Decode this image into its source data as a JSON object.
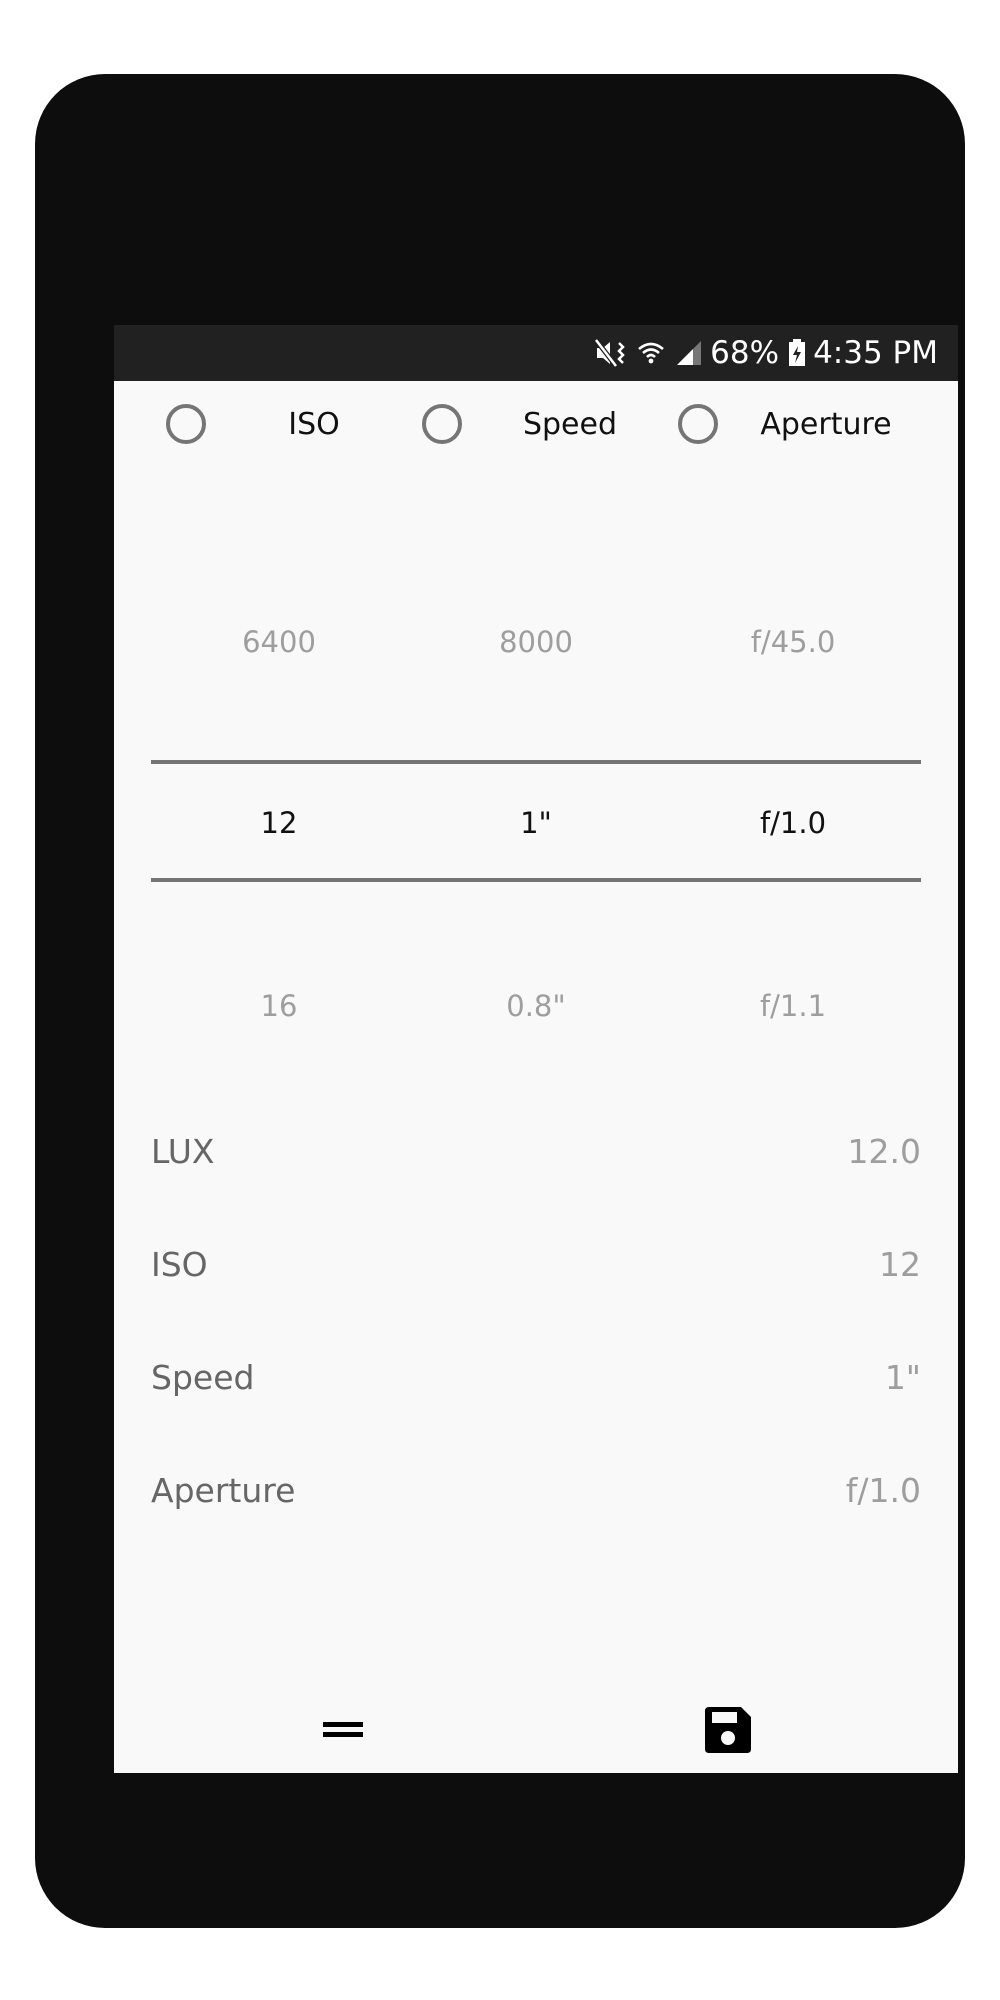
{
  "status_bar": {
    "battery_text": "68%",
    "time": "4:35 PM",
    "icons": [
      "mute-vibrate-icon",
      "wifi-icon",
      "signal-icon",
      "battery-charging-icon"
    ]
  },
  "mode_selector": {
    "options": [
      {
        "label": "ISO",
        "selected": false
      },
      {
        "label": "Speed",
        "selected": false
      },
      {
        "label": "Aperture",
        "selected": false
      }
    ]
  },
  "pickers": {
    "iso": {
      "prev": "6400",
      "current": "12",
      "next": "16"
    },
    "speed": {
      "prev": "8000",
      "current": "1\"",
      "next": "0.8\""
    },
    "aperture": {
      "prev": "f/45.0",
      "current": "f/1.0",
      "next": "f/1.1"
    }
  },
  "readings": [
    {
      "label": "LUX",
      "value": "12.0"
    },
    {
      "label": "ISO",
      "value": "12"
    },
    {
      "label": "Speed",
      "value": "1\""
    },
    {
      "label": "Aperture",
      "value": "f/1.0"
    }
  ],
  "bottom_bar": {
    "left_icon": "equals-icon",
    "right_icon": "save-icon"
  },
  "colors": {
    "device": "#0d0d0d",
    "status_bar": "#212121",
    "screen": "#f9f9f9",
    "divider": "#757575"
  }
}
